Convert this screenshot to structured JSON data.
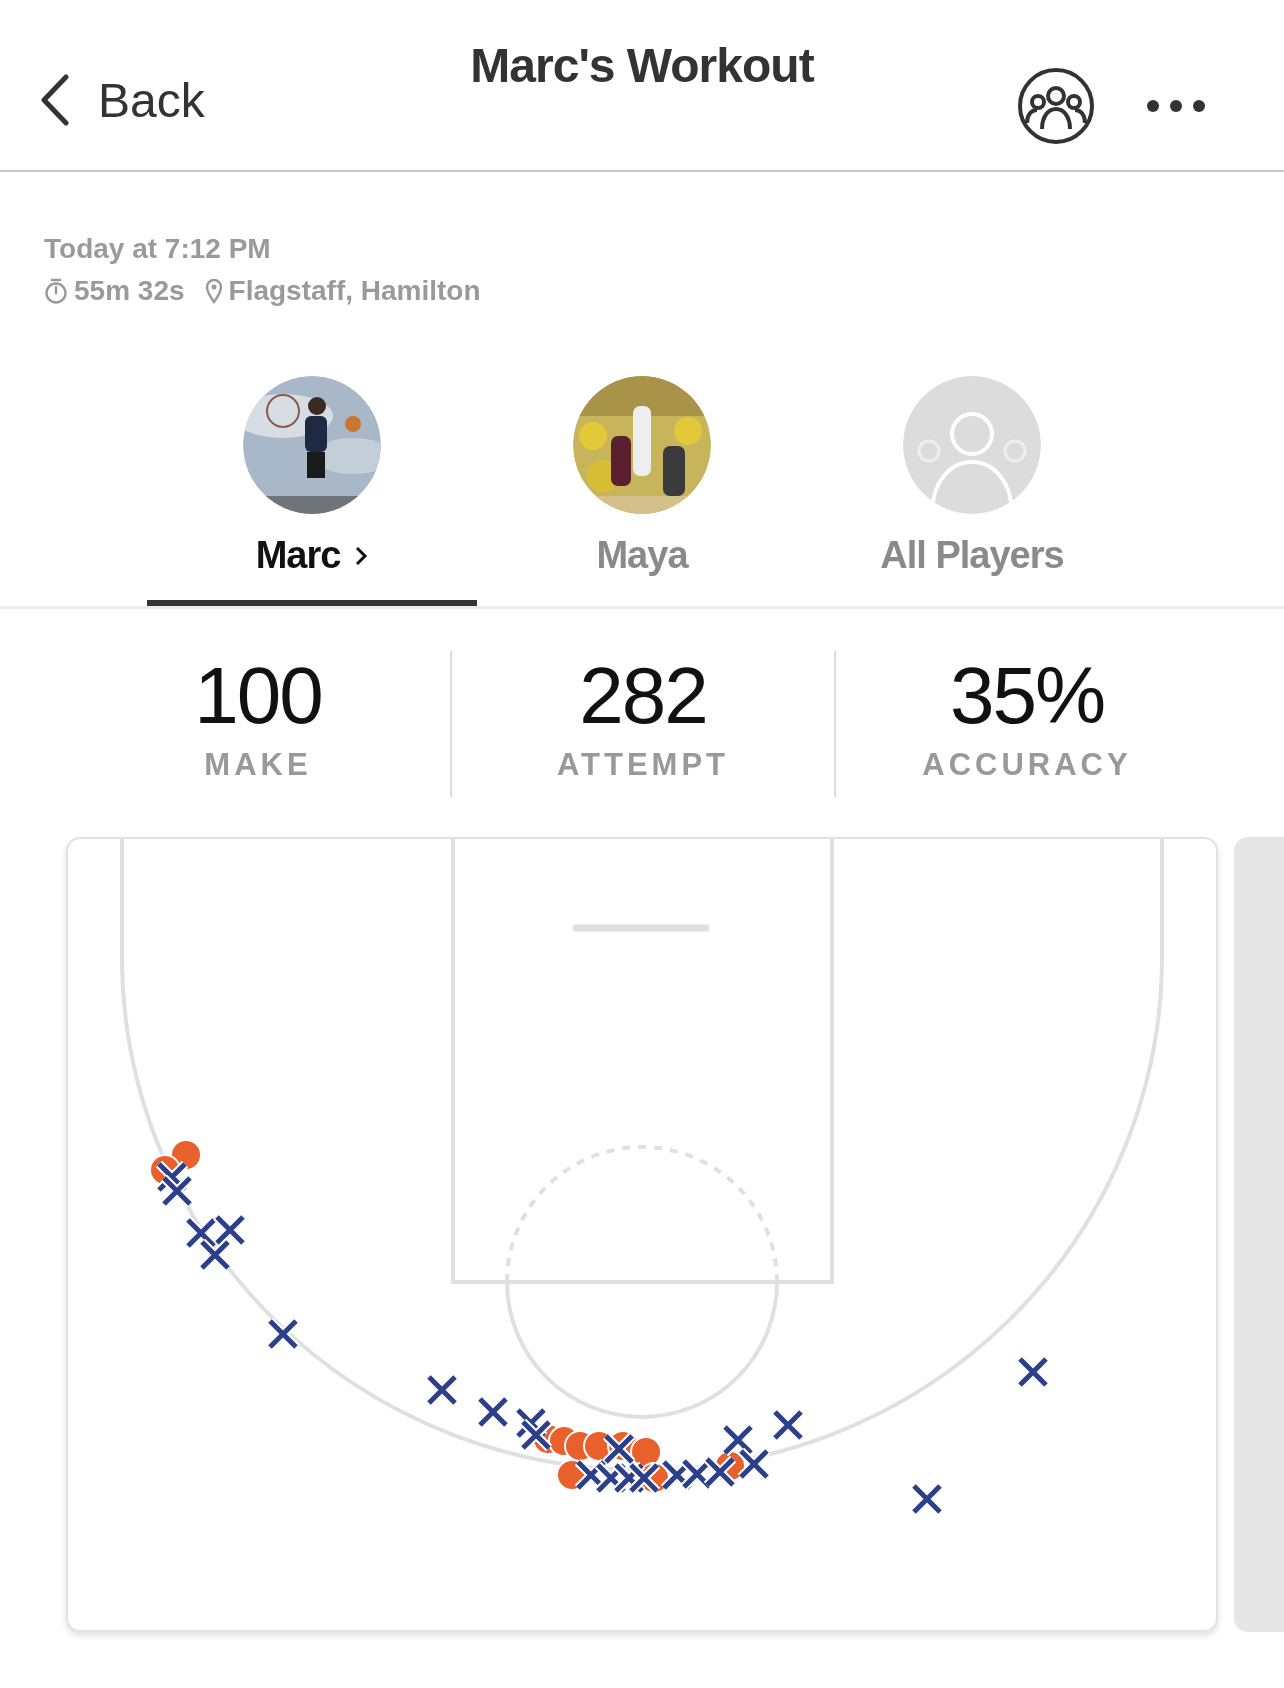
{
  "nav": {
    "back": "Back",
    "title": "Marc's Workout"
  },
  "session": {
    "date": "Today at 7:12 PM",
    "duration": "55m 32s",
    "location": "Flagstaff, Hamilton"
  },
  "players": [
    {
      "name": "Marc",
      "selected": true
    },
    {
      "name": "Maya",
      "selected": false
    },
    {
      "name": "All Players",
      "selected": false,
      "kind": "placeholder"
    }
  ],
  "stats": [
    {
      "value": "100",
      "label": "MAKE"
    },
    {
      "value": "282",
      "label": "ATTEMPT"
    },
    {
      "value": "35%",
      "label": "ACCURACY"
    }
  ]
}
